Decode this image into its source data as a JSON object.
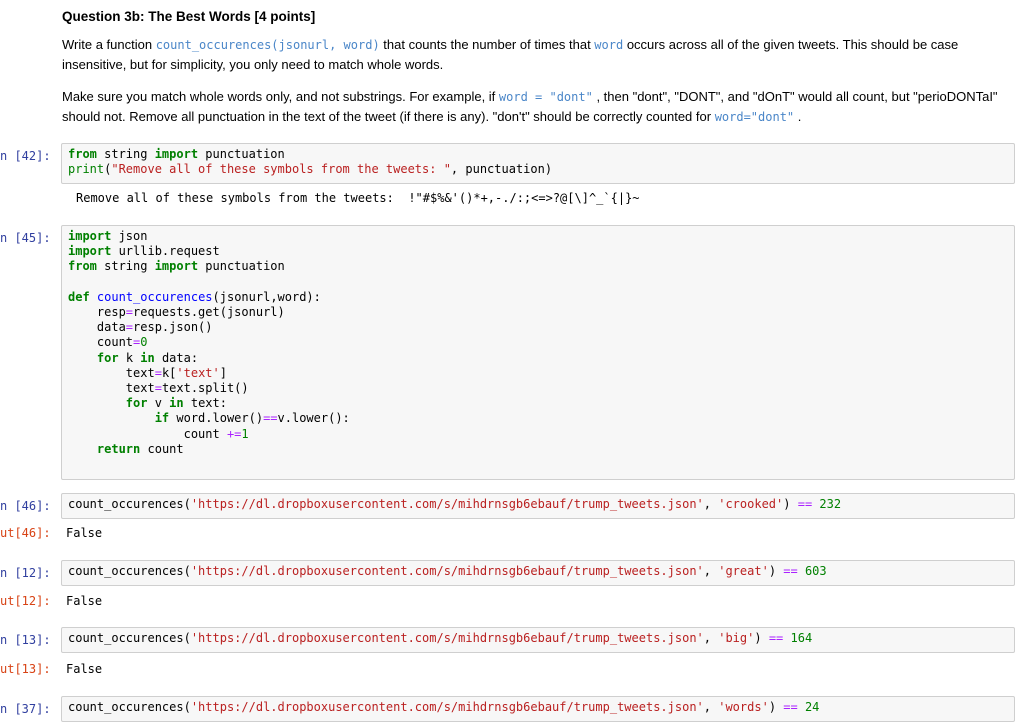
{
  "question": {
    "title": "Question 3b: The Best Words [4 points]",
    "p1_a": "Write a function ",
    "p1_code": "count_occurences(jsonurl, word)",
    "p1_b": " that counts the number of times that ",
    "p1_code2": "word",
    "p1_c": " occurs across all of the given tweets. This should be case insensitive, but for simplicity, you only need to match whole words.",
    "p2_a": "Make sure you match whole words only, and not substrings. For example, if ",
    "p2_code": "word = \"dont\"",
    "p2_b": " , then \"dont\", \"DONT\", and \"dOnT\" would all count, but \"perioDONTaI\" should not. Remove all punctuation in the text of the tweet (if there is any). \"don't\" should be correctly counted for ",
    "p2_code2": "word=\"dont\"",
    "p2_c": " ."
  },
  "cells": {
    "c42": {
      "prompt": "n [42]:",
      "line1_kw1": "from",
      "line1_mid": " string ",
      "line1_kw2": "import",
      "line1_end": " punctuation",
      "line2_fn": "print",
      "line2_open": "(",
      "line2_str": "\"Remove all of these symbols from the tweets: \"",
      "line2_end": ", punctuation)",
      "output": "Remove all of these symbols from the tweets:  !\"#$%&'()*+,-./:;<=>?@[\\]^_`{|}~"
    },
    "c45": {
      "prompt": "n [45]:",
      "imp1_kw": "import",
      "imp1_rest": " json",
      "imp2_kw": "import",
      "imp2_rest": " urllib.request",
      "imp3_kw1": "from",
      "imp3_mid": " string ",
      "imp3_kw2": "import",
      "imp3_rest": " punctuation",
      "def_kw": "def",
      "def_name": "count_occurences",
      "def_args": "(jsonurl,word):",
      "l_resp_a": "    resp",
      "l_resp_op": "=",
      "l_resp_b": "requests.get(jsonurl)",
      "l_data_a": "    data",
      "l_data_op": "=",
      "l_data_b": "resp.json()",
      "l_count_a": "    count",
      "l_count_op": "=",
      "l_count_num": "0",
      "l_for1_kw": "for",
      "l_for1_mid": " k ",
      "l_for1_kw2": "in",
      "l_for1_end": " data:",
      "l_text1_a": "        text",
      "l_text1_op": "=",
      "l_text1_b": "k[",
      "l_text1_str": "'text'",
      "l_text1_c": "]",
      "l_text2_a": "        text",
      "l_text2_op": "=",
      "l_text2_b": "text.split()",
      "l_for2_kw": "for",
      "l_for2_mid": " v ",
      "l_for2_kw2": "in",
      "l_for2_end": " text:",
      "l_if_kw": "if",
      "l_if_a": " word.lower()",
      "l_if_op": "==",
      "l_if_b": "v.lower():",
      "l_inc_a": "                count ",
      "l_inc_op": "+=",
      "l_inc_num": "1",
      "l_ret_kw": "return",
      "l_ret_rest": " count"
    },
    "c46": {
      "prompt": "n [46]:",
      "out_prompt": "ut[46]:",
      "fn": "count_occurences(",
      "url": "'https://dl.dropboxusercontent.com/s/mihdrnsgb6ebauf/trump_tweets.json'",
      "sep": ", ",
      "word": "'crooked'",
      "close": ") ",
      "eq": "==",
      "num": "232",
      "output": "False"
    },
    "c12": {
      "prompt": "n [12]:",
      "out_prompt": "ut[12]:",
      "fn": "count_occurences(",
      "url": "'https://dl.dropboxusercontent.com/s/mihdrnsgb6ebauf/trump_tweets.json'",
      "sep": ", ",
      "word": "'great'",
      "close": ") ",
      "eq": "==",
      "num": "603",
      "output": "False"
    },
    "c13": {
      "prompt": "n [13]:",
      "out_prompt": "ut[13]:",
      "fn": "count_occurences(",
      "url": "'https://dl.dropboxusercontent.com/s/mihdrnsgb6ebauf/trump_tweets.json'",
      "sep": ", ",
      "word": "'big'",
      "close": ") ",
      "eq": "==",
      "num": "164",
      "output": "False"
    },
    "c37": {
      "prompt": "n [37]:",
      "fn": "count_occurences(",
      "url": "'https://dl.dropboxusercontent.com/s/mihdrnsgb6ebauf/trump_tweets.json'",
      "sep": ", ",
      "word": "'words'",
      "close": ") ",
      "eq": "==",
      "num": "24"
    }
  }
}
